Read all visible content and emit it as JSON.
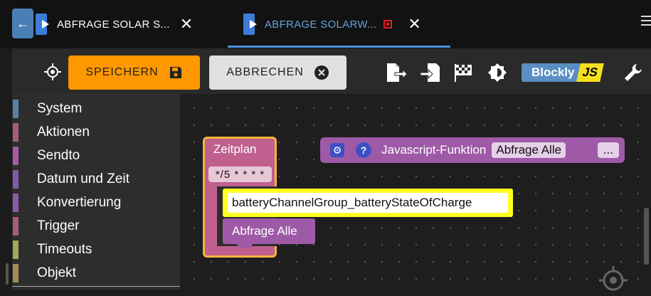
{
  "tabs": [
    {
      "title": "ABFRAGE SOLAR S...",
      "active": false
    },
    {
      "title": "ABFRAGE SOLARW...",
      "active": true,
      "unsaved": true
    }
  ],
  "toolbar": {
    "save_label": "SPEICHERN",
    "cancel_label": "ABBRECHEN",
    "blockly_label": "Blockly",
    "js_label": "JS"
  },
  "sidebar": {
    "categories": [
      {
        "label": "System",
        "color": "#5b80a5"
      },
      {
        "label": "Aktionen",
        "color": "#a55b80"
      },
      {
        "label": "Sendto",
        "color": "#a55ba5"
      },
      {
        "label": "Datum und Zeit",
        "color": "#805ba5"
      },
      {
        "label": "Konvertierung",
        "color": "#8a5ba5"
      },
      {
        "label": "Trigger",
        "color": "#a55b80"
      },
      {
        "label": "Timeouts",
        "color": "#a5a55b"
      },
      {
        "label": "Objekt",
        "color": "#a58a5b"
      }
    ]
  },
  "blocks": {
    "schedule": {
      "label": "Zeitplan",
      "cron": "*/5 * * * *"
    },
    "channel": {
      "text": "batteryChannelGroup_batteryStateOfCharge"
    },
    "call": {
      "label": "Abfrage Alle"
    },
    "js_function": {
      "label": "Javascript-Funktion",
      "name": "Abfrage Alle",
      "more": "..."
    }
  },
  "colors": {
    "accent": "#ff9800",
    "tab_active": "#4a90d9",
    "procedure_block": "#9e5aa6",
    "schedule_block": "#c0608e",
    "selected_outline": "#f2b43c",
    "highlight": "#ffff22"
  }
}
